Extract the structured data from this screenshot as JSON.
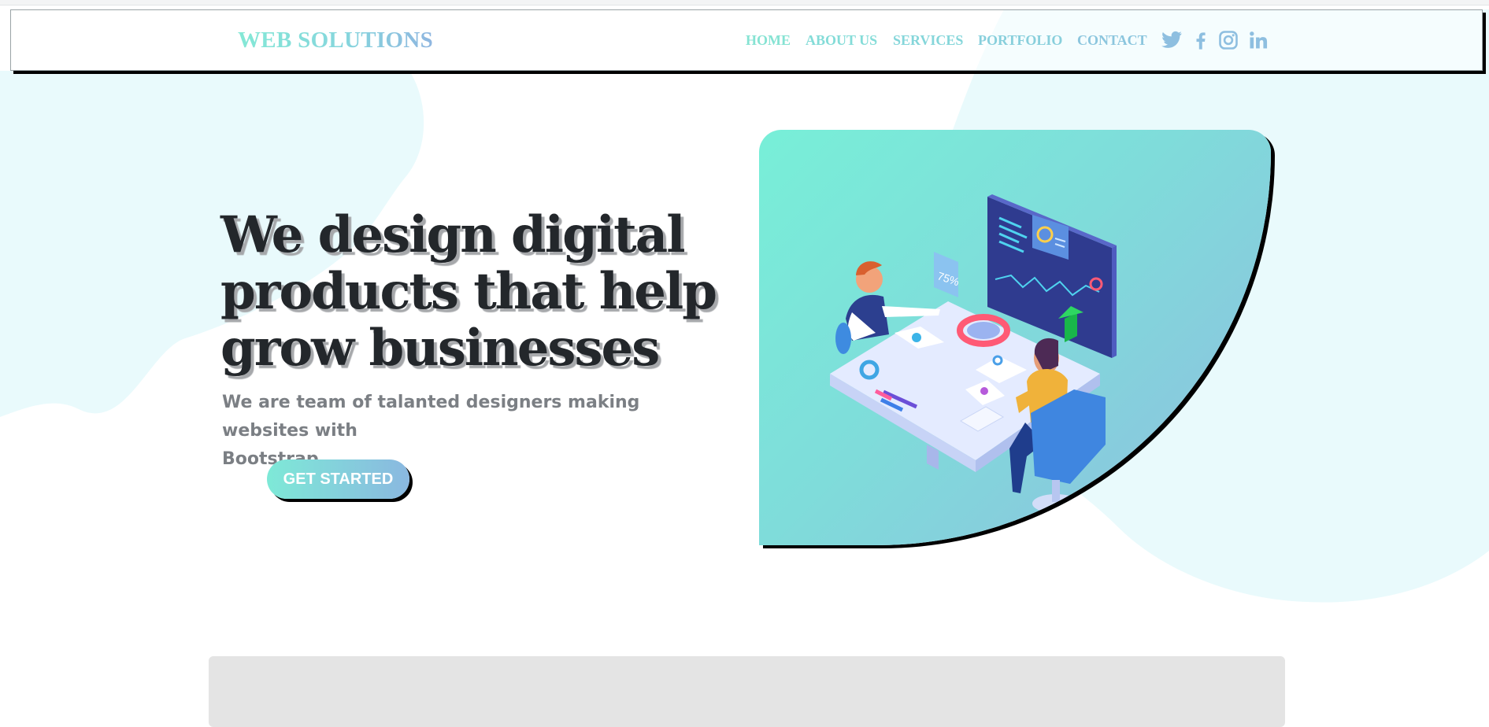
{
  "navbar": {
    "brand": "WEB SOLUTIONS",
    "links": [
      "HOME",
      "ABOUT US",
      "SERVICES",
      "PORTFOLIO",
      "CONTACT"
    ],
    "social_icons": [
      "twitter-icon",
      "facebook-icon",
      "instagram-icon",
      "linkedin-icon"
    ]
  },
  "hero": {
    "title_lines": [
      "We design digital",
      "products that help",
      "grow businesses"
    ],
    "subtitle_lines": [
      "We are team of talanted designers making websites with",
      "Bootstrap"
    ],
    "cta_label": "GET STARTED",
    "illustration": {
      "badge_text": "75%"
    }
  },
  "colors": {
    "accent_start": "#7ee9d7",
    "accent_end": "#8ab8e0",
    "blob": "#e9fafc",
    "title": "#23272b",
    "subtitle": "#7b7f84"
  }
}
